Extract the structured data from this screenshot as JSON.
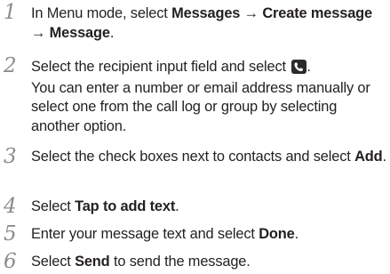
{
  "steps": [
    {
      "number": "1",
      "line1_pre": "In Menu mode, select ",
      "line1_b1": "Messages",
      "line1_arrow": " → ",
      "line1_b2": "Create message",
      "line2_arrow": "→ ",
      "line2_b": "Message",
      "line2_post": "."
    },
    {
      "number": "2",
      "pre": "Select the recipient input field and select ",
      "icon": "phone-book-icon",
      "post": ".",
      "note": "You can enter a number or email address manually or select one from the call log or group by selecting another option."
    },
    {
      "number": "3",
      "pre": "Select the check boxes next to contacts and select ",
      "bold": "Add",
      "post": "."
    },
    {
      "number": "4",
      "pre": "Select ",
      "bold": "Tap to add text",
      "post": "."
    },
    {
      "number": "5",
      "pre": "Enter your message text and select ",
      "bold": "Done",
      "post": "."
    },
    {
      "number": "6",
      "pre": "Select ",
      "bold": "Send",
      "post": " to send the message."
    }
  ]
}
